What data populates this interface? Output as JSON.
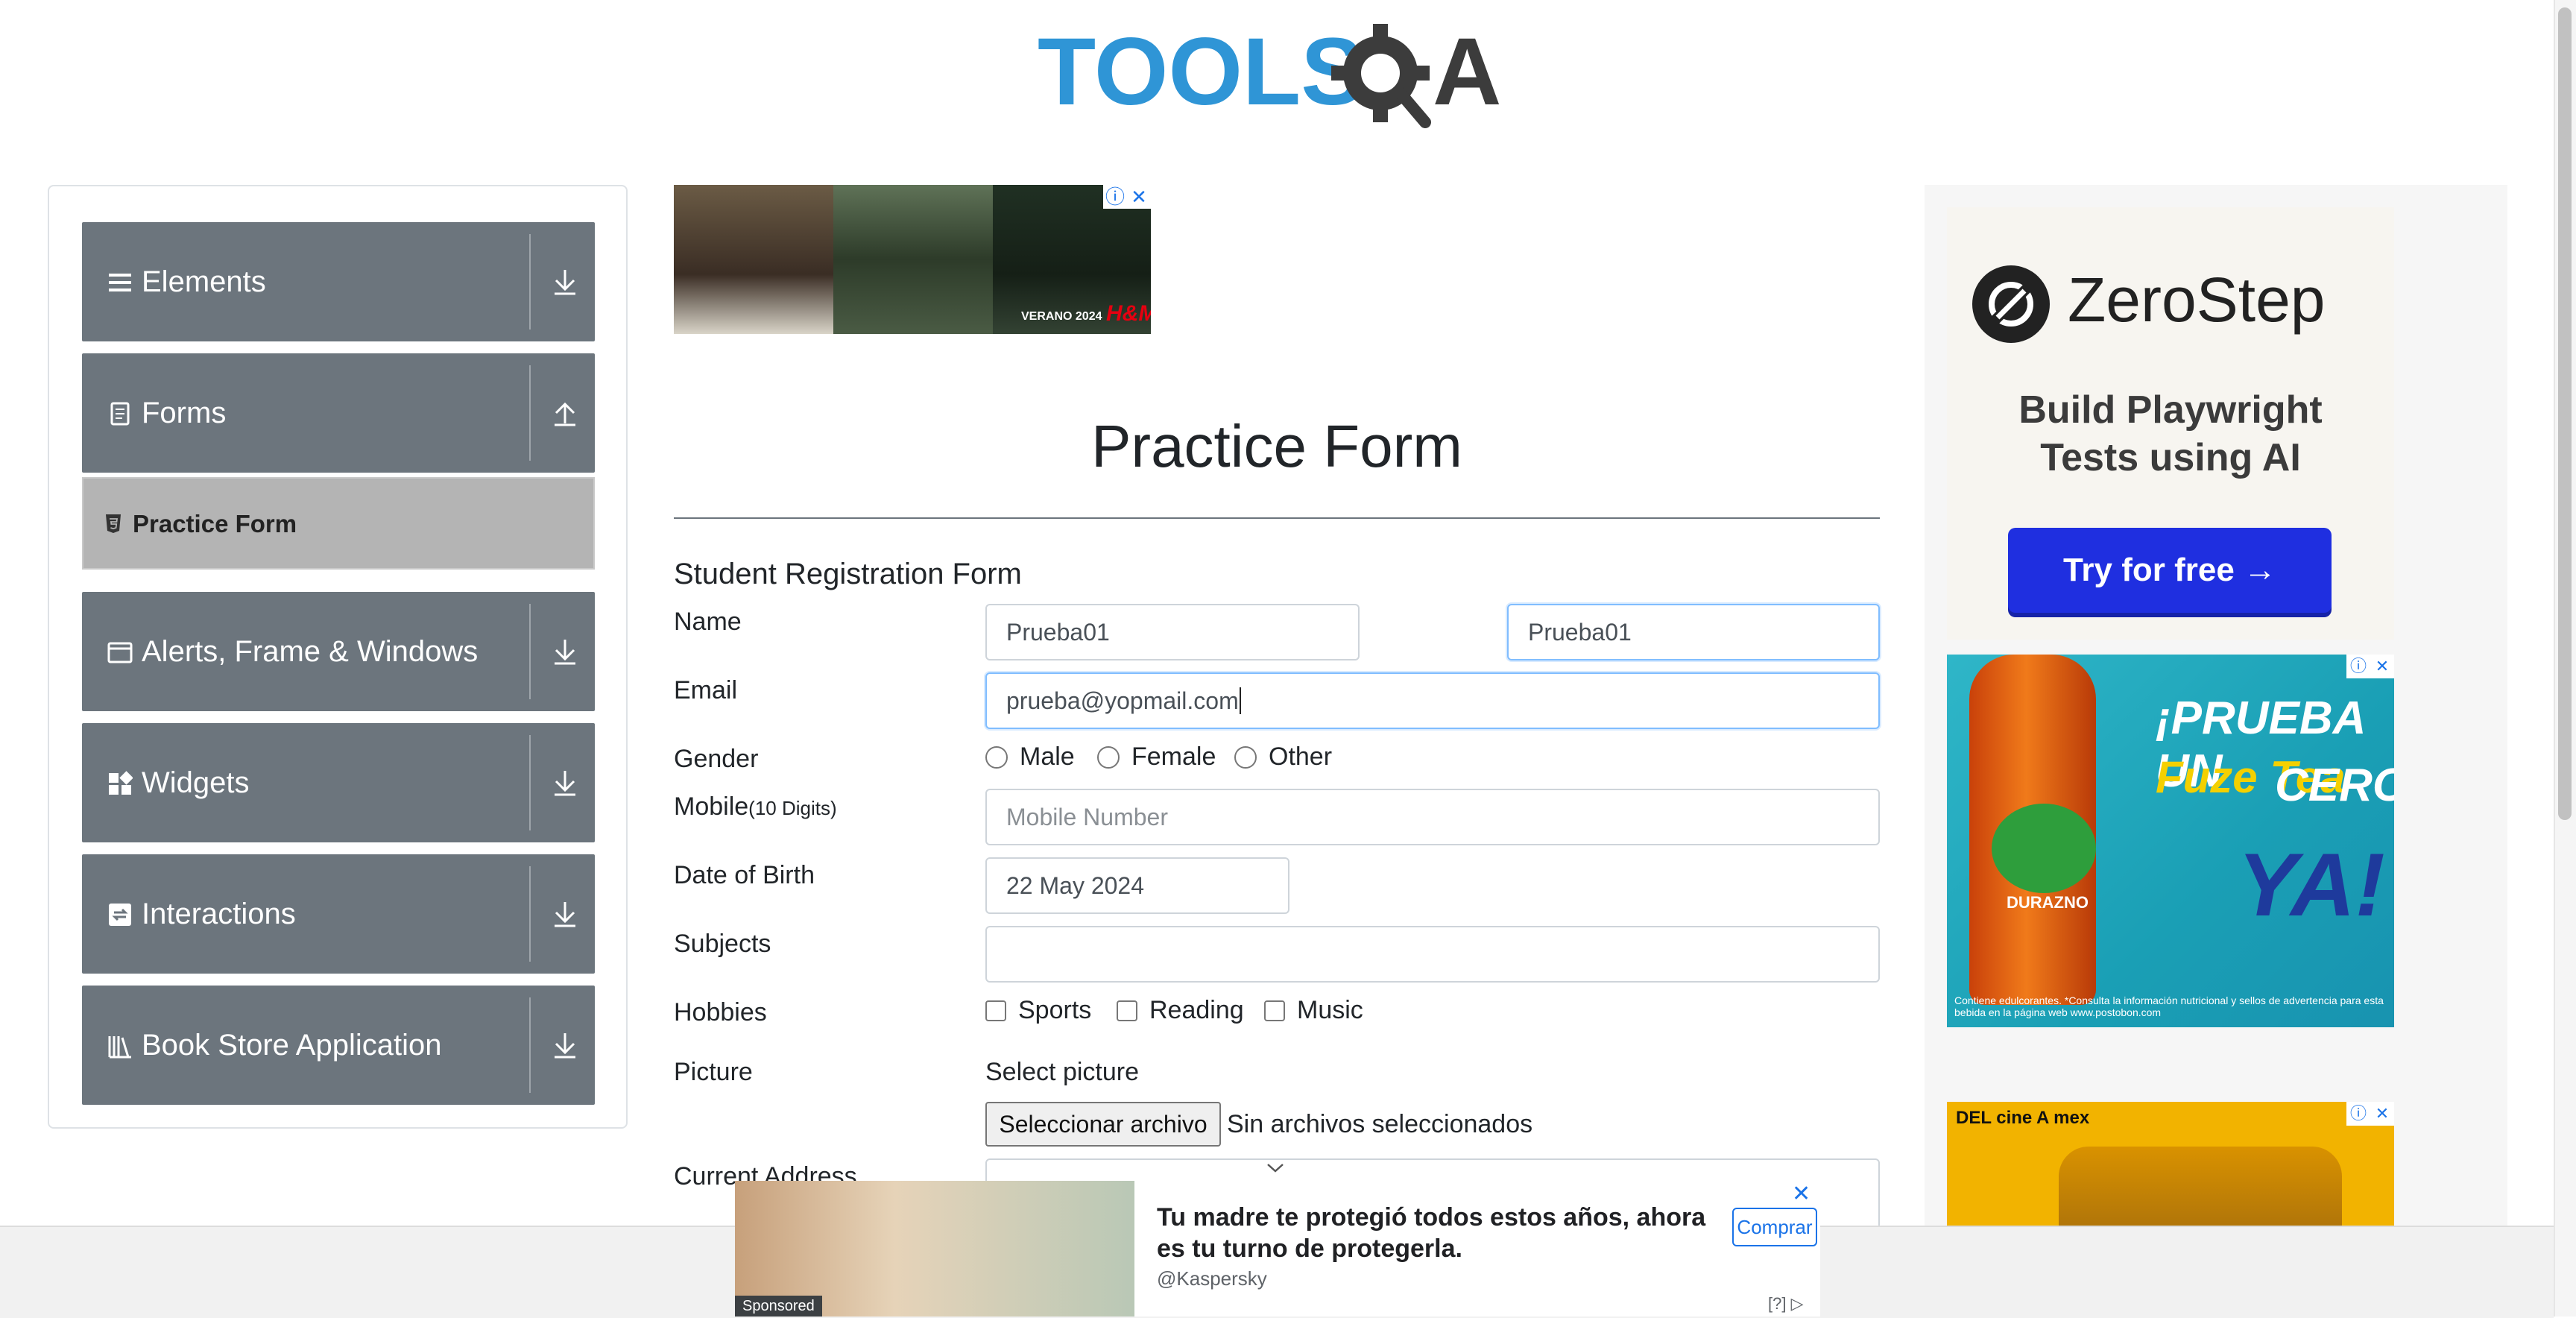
{
  "logo": {
    "text_tools": "TOOLS",
    "text_qa": "QA"
  },
  "sidebar": {
    "groups": [
      {
        "label": "Elements",
        "icon": "menu-icon"
      },
      {
        "label": "Forms",
        "icon": "document-icon"
      },
      {
        "label": "Alerts, Frame & Windows",
        "icon": "window-icon"
      },
      {
        "label": "Widgets",
        "icon": "widgets-icon"
      },
      {
        "label": "Interactions",
        "icon": "interactions-icon"
      },
      {
        "label": "Book Store Application",
        "icon": "books-icon"
      }
    ],
    "active_item": {
      "label": "Practice Form",
      "icon": "html5-icon"
    }
  },
  "top_ad": {
    "caption": "VERANO 2024",
    "brand": "H&M"
  },
  "main": {
    "title": "Practice Form",
    "form_title": "Student Registration Form",
    "labels": {
      "name": "Name",
      "email": "Email",
      "gender": "Gender",
      "mobile": "Mobile",
      "mobile_hint": "(10 Digits)",
      "dob": "Date of Birth",
      "subjects": "Subjects",
      "hobbies": "Hobbies",
      "picture": "Picture",
      "current_address": "Current Address"
    },
    "first_name": "Prueba01",
    "last_name": "Prueba01",
    "email_value": "prueba@yopmail.com",
    "gender_options": [
      "Male",
      "Female",
      "Other"
    ],
    "mobile_placeholder": "Mobile Number",
    "dob_value": "22 May 2024",
    "subjects_value": "",
    "hobbies_options": [
      "Sports",
      "Reading",
      "Music"
    ],
    "picture_label": "Select picture",
    "file_button": "Seleccionar archivo",
    "file_status": "Sin archivos seleccionados"
  },
  "right_ads": {
    "zerostep": {
      "brand": "ZeroStep",
      "tagline": "Build Playwright Tests using AI",
      "cta": "Try for free →"
    },
    "fuzetea": {
      "headline": "¡PRUEBA UN",
      "brand": "Fuze Tea",
      "line2": "CERO",
      "line3": "YA!",
      "flavor": "DURAZNO",
      "fineprint": "Contiene edulcorantes. *Consulta la información nutricional y sellos de advertencia para esta bebida en la página web www.postobon.com"
    },
    "cine": {
      "text": "DEL cine A mex"
    }
  },
  "bottom_ad": {
    "headline": "Tu madre te protegió todos estos años, ahora es tu turno de protegerla.",
    "source": "@Kaspersky",
    "cta": "Comprar",
    "sponsored": "Sponsored",
    "info": "[?]"
  },
  "colors": {
    "menu_bg": "#6c757d",
    "active_item_bg": "#b4b4b4",
    "logo_blue": "#2f95d6",
    "logo_dark": "#3c3c3c",
    "zs_button": "#1f2fe0"
  }
}
